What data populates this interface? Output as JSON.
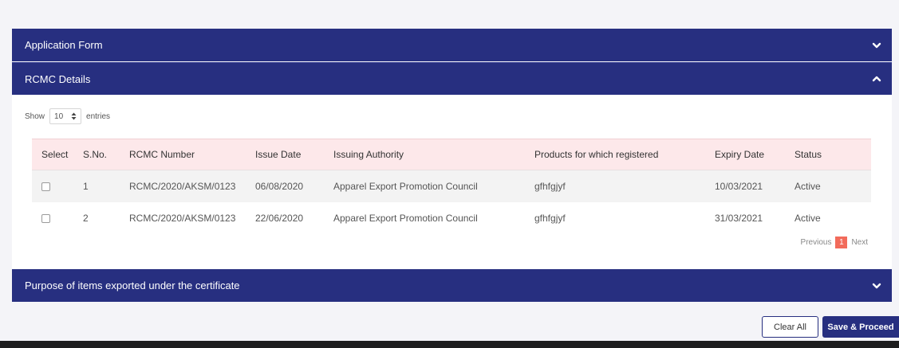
{
  "panels": {
    "application_form": {
      "title": "Application Form"
    },
    "rcmc_details": {
      "title": "RCMC Details"
    },
    "purpose": {
      "title": "Purpose of items exported under the certificate"
    }
  },
  "table_controls": {
    "show_label": "Show",
    "entries_value": "10",
    "entries_label": "entries"
  },
  "table": {
    "headers": [
      "Select",
      "S.No.",
      "RCMC Number",
      "Issue Date",
      "Issuing Authority",
      "Products for which registered",
      "Expiry Date",
      "Status"
    ],
    "rows": [
      {
        "sno": "1",
        "rcmc_number": "RCMC/2020/AKSM/0123",
        "issue_date": "06/08/2020",
        "issuing_authority": "Apparel Export Promotion Council",
        "products": "gfhfgjyf",
        "expiry_date": "10/03/2021",
        "status": "Active"
      },
      {
        "sno": "2",
        "rcmc_number": "RCMC/2020/AKSM/0123",
        "issue_date": "22/06/2020",
        "issuing_authority": "Apparel Export Promotion Council",
        "products": "gfhfgjyf",
        "expiry_date": "31/03/2021",
        "status": "Active"
      }
    ]
  },
  "pagination": {
    "previous": "Previous",
    "current_page": "1",
    "next": "Next"
  },
  "actions": {
    "clear_all": "Clear All",
    "save_proceed": "Save & Proceed"
  },
  "colors": {
    "header_bg": "#272f80",
    "table_header_bg": "#fde8ea",
    "active_page": "#f26b5b"
  },
  "icons": {
    "collapsed": "chevron-down-icon",
    "expanded": "chevron-up-icon",
    "sort": "sort-arrows-icon"
  }
}
